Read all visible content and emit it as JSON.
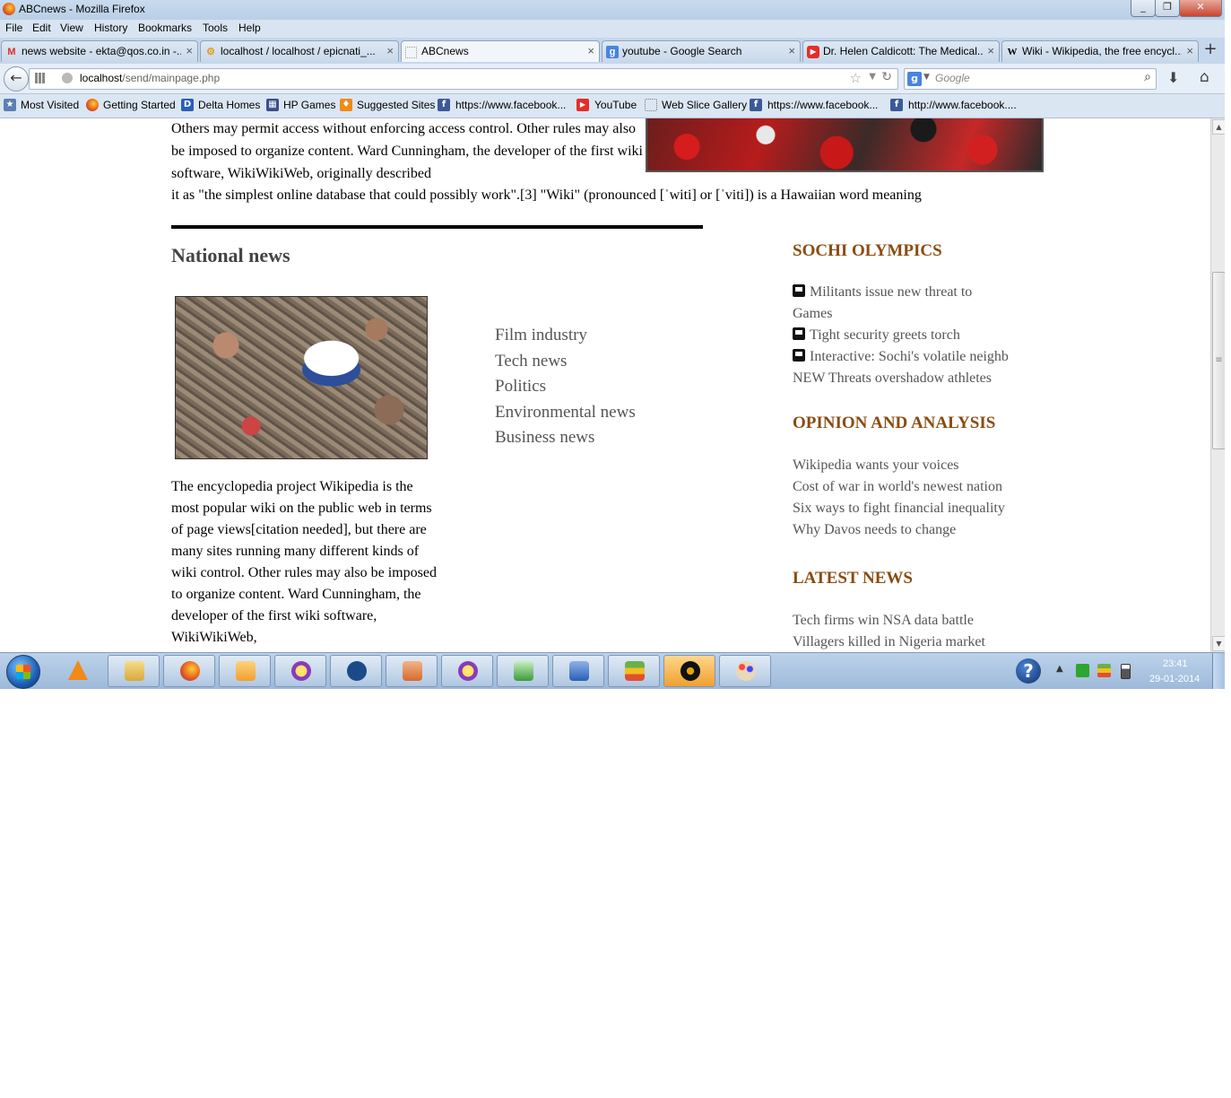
{
  "window": {
    "title": "ABCnews - Mozilla Firefox",
    "min_label": "_",
    "max_label": "❐",
    "close_label": "✕"
  },
  "menu": [
    "File",
    "Edit",
    "View",
    "History",
    "Bookmarks",
    "Tools",
    "Help"
  ],
  "tabs": [
    {
      "icon": "gmail-icon",
      "glyph": "M",
      "color": "#d93025",
      "label": "news website - ekta@qos.co.in -..."
    },
    {
      "icon": "phpmyadmin-icon",
      "glyph": "⚙",
      "color": "#e0a020",
      "label": "localhost / localhost / epicnati_..."
    },
    {
      "icon": "blank-page-icon",
      "glyph": "",
      "color": "#999999",
      "label": "ABCnews",
      "active": true
    },
    {
      "icon": "google-icon",
      "glyph": "g",
      "color": "#4a83e0",
      "label": "youtube - Google Search"
    },
    {
      "icon": "youtube-icon",
      "glyph": "▶",
      "color": "#e52d27",
      "label": "Dr. Helen Caldicott: The Medical..."
    },
    {
      "icon": "wikipedia-icon",
      "glyph": "W",
      "color": "#000000",
      "label": "Wiki - Wikipedia, the free encycl..."
    }
  ],
  "new_tab_label": "+",
  "url": {
    "host": "localhost",
    "path": "/send/mainpage.php"
  },
  "search": {
    "placeholder": "Google",
    "engine_glyph": "g"
  },
  "bookmarks": [
    {
      "icon": "bookmarks-star-icon",
      "glyph": "★",
      "color": "#4a6fa5",
      "label": "Most Visited"
    },
    {
      "icon": "firefox-icon",
      "glyph": "",
      "color": "#e5541d",
      "label": "Getting Started"
    },
    {
      "icon": "delta-d-icon",
      "glyph": "D",
      "color": "#2b5fb3",
      "label": "Delta Homes"
    },
    {
      "icon": "hp-games-icon",
      "glyph": "▦",
      "color": "#3a4f8a",
      "label": "HP Games"
    },
    {
      "icon": "suggested-sites-icon",
      "glyph": "♦",
      "color": "#f08a18",
      "label": "Suggested Sites"
    },
    {
      "icon": "facebook-icon",
      "glyph": "f",
      "color": "#3b5998",
      "label": "https://www.facebook..."
    },
    {
      "icon": "youtube-icon",
      "glyph": "▶",
      "color": "#e52d27",
      "label": "YouTube"
    },
    {
      "icon": "web-slice-icon",
      "glyph": "",
      "color": "#ffffff",
      "label": "Web Slice Gallery"
    },
    {
      "icon": "facebook-icon",
      "glyph": "f",
      "color": "#3b5998",
      "label": "https://www.facebook..."
    },
    {
      "icon": "facebook-icon",
      "glyph": "f",
      "color": "#3b5998",
      "label": "http://www.facebook...."
    }
  ],
  "page": {
    "top_para": "Others may permit access without enforcing access control. Other rules may also be imposed to organize content. Ward Cunningham, the developer of the first wiki software, WikiWikiWeb, originally described",
    "top_para_last": "it as \"the simplest online database that could possibly work\".[3] \"Wiki\" (pronounced [ˈwiti] or [ˈviti]) is a Hawaiian word meaning",
    "national_heading": "National news",
    "national_para": "The encyclopedia project Wikipedia is the most popular wiki on the public web in terms of page views[citation needed], but there are many sites running many different kinds of wiki control. Other rules may also be imposed to organize content. Ward Cunningham, the developer of the first wiki software, WikiWikiWeb,",
    "categories": [
      "Film industry",
      "Tech news",
      "Politics",
      "Environmental news",
      "Business news"
    ],
    "sochi": {
      "heading": "SOCHI OLYMPICS",
      "items": [
        {
          "video": true,
          "text": "Militants issue new threat to"
        },
        {
          "video": false,
          "text": "Games"
        },
        {
          "video": true,
          "text": "Tight security greets torch"
        },
        {
          "video": true,
          "text": "Interactive: Sochi's volatile neighb"
        },
        {
          "video": false,
          "text": "NEW Threats overshadow athletes"
        }
      ]
    },
    "opinion": {
      "heading": "OPINION AND ANALYSIS",
      "items": [
        "Wikipedia wants your voices",
        "Cost of war in world's newest nation",
        "Six ways to fight financial inequality",
        "Why Davos needs to change"
      ]
    },
    "latest": {
      "heading": "LATEST NEWS",
      "items": [
        "Tech firms win NSA data battle",
        "Villagers killed in Nigeria market"
      ]
    }
  },
  "taskbar": {
    "apps": [
      {
        "icon": "vlc-icon",
        "color": "#f08a18",
        "pinned": true
      },
      {
        "icon": "file-explorer-icon",
        "color": "#e8c060",
        "pinned": false
      },
      {
        "icon": "firefox-icon",
        "color": "#e5541d",
        "pinned": false
      },
      {
        "icon": "media-player-icon",
        "color": "#f0a030",
        "pinned": false
      },
      {
        "icon": "yahoo-messenger-icon",
        "color": "#8a3ab9",
        "pinned": false
      },
      {
        "icon": "hp-icon",
        "color": "#1a4a8a",
        "pinned": false
      },
      {
        "icon": "presentation-icon",
        "color": "#d66a2a",
        "pinned": false
      },
      {
        "icon": "yahoo-messenger-2-icon",
        "color": "#8a3ab9",
        "pinned": false
      },
      {
        "icon": "task-manager-icon",
        "color": "#3a9a3a",
        "pinned": false
      },
      {
        "icon": "word-icon",
        "color": "#2b5fb3",
        "pinned": false
      },
      {
        "icon": "bluestacks-icon",
        "color": "#6ab04c",
        "pinned": false
      },
      {
        "icon": "winamp-icon",
        "color": "#e5a500",
        "pinned": false
      },
      {
        "icon": "paint-icon",
        "color": "#c0a060",
        "pinned": false
      }
    ],
    "clock_time": "23:41",
    "clock_date": "29-01-2014"
  }
}
